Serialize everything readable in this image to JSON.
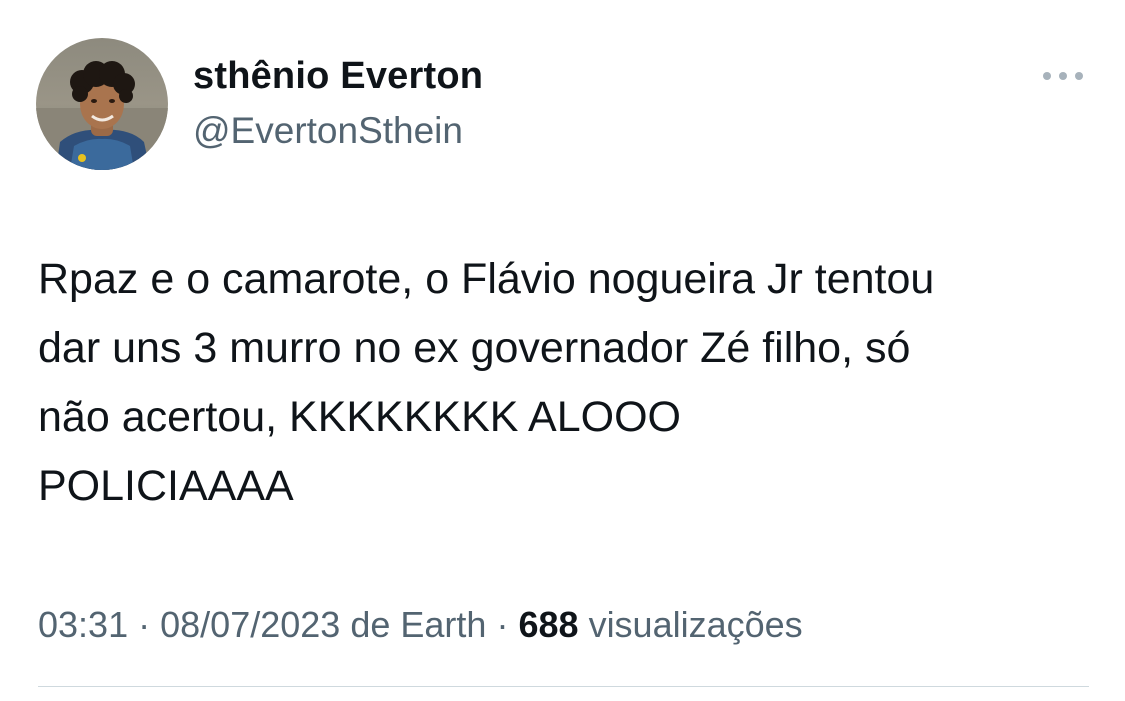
{
  "author": {
    "display_name": "sthênio Everton",
    "handle": "@EvertonSthein"
  },
  "tweet": {
    "lines": [
      "Rpaz e o camarote, o Flávio nogueira Jr tentou",
      "dar uns 3 murro no ex governador Zé filho, só",
      "não acertou, KKKKKKKK ALOOO",
      "POLICIAAAA"
    ]
  },
  "meta": {
    "time": "03:31",
    "separator": "·",
    "date": "08/07/2023",
    "source_prefix": "de",
    "source": "Earth",
    "views_count": "688",
    "views_label": "visualizações"
  },
  "icons": {
    "avatar": "profile-photo",
    "more": "more-dots-icon"
  },
  "colors": {
    "text_primary": "#0f1419",
    "text_secondary": "#536471",
    "divider": "#cfd9de"
  }
}
